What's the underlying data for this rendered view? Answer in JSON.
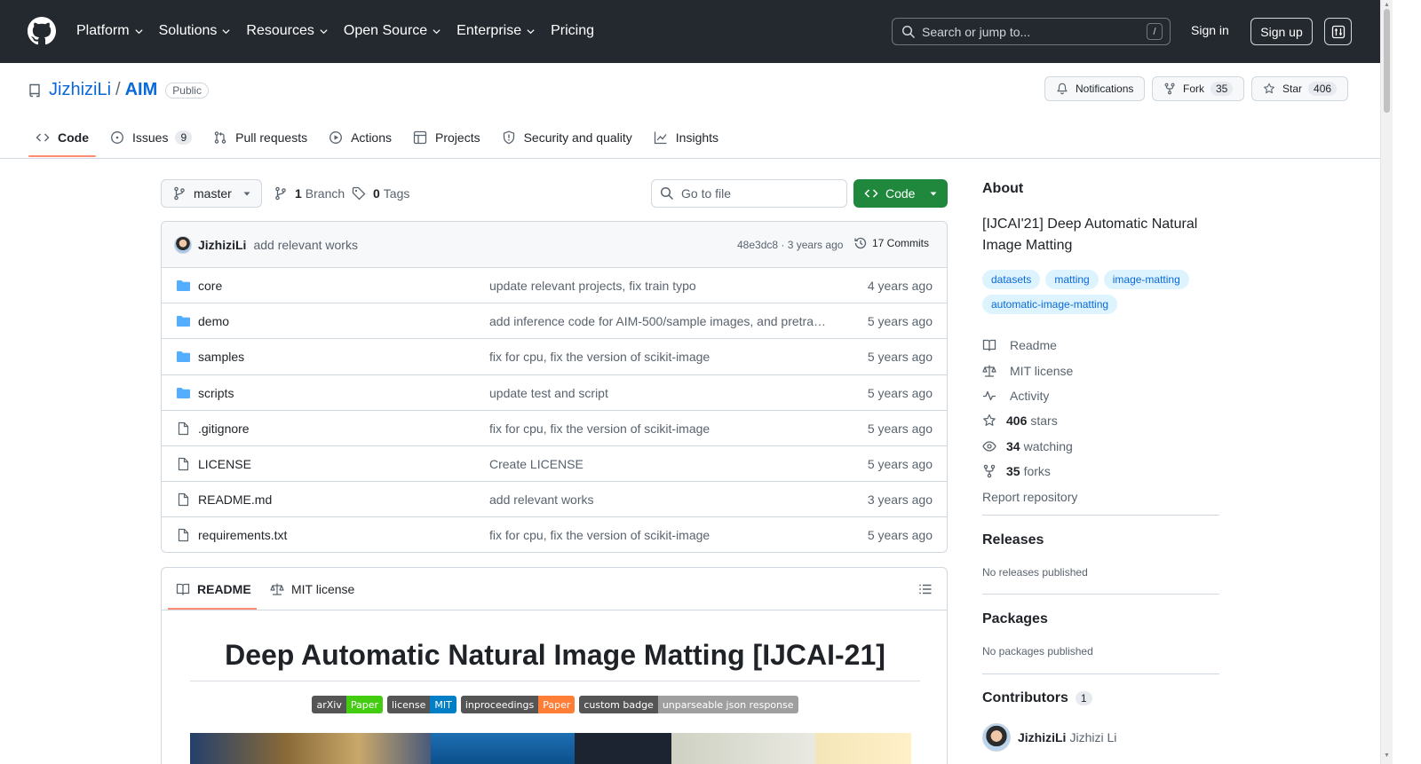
{
  "header": {
    "nav": [
      {
        "label": "Platform",
        "has_menu": true
      },
      {
        "label": "Solutions",
        "has_menu": true
      },
      {
        "label": "Resources",
        "has_menu": true
      },
      {
        "label": "Open Source",
        "has_menu": true
      },
      {
        "label": "Enterprise",
        "has_menu": true
      },
      {
        "label": "Pricing",
        "has_menu": false
      }
    ],
    "search_placeholder": "Search or jump to...",
    "search_key": "/",
    "signin": "Sign in",
    "signup": "Sign up"
  },
  "repo": {
    "owner": "JizhiziLi",
    "separator": "/",
    "name": "AIM",
    "visibility": "Public",
    "notifications_label": "Notifications",
    "fork_label": "Fork",
    "fork_count": "35",
    "star_label": "Star",
    "star_count": "406"
  },
  "tabs": [
    {
      "label": "Code",
      "icon": "code-icon",
      "count": null,
      "active": true
    },
    {
      "label": "Issues",
      "icon": "issue-icon",
      "count": "9",
      "active": false
    },
    {
      "label": "Pull requests",
      "icon": "pull-request-icon",
      "count": null,
      "active": false
    },
    {
      "label": "Actions",
      "icon": "play-icon",
      "count": null,
      "active": false
    },
    {
      "label": "Projects",
      "icon": "table-icon",
      "count": null,
      "active": false
    },
    {
      "label": "Security and quality",
      "icon": "shield-icon",
      "count": null,
      "active": false
    },
    {
      "label": "Insights",
      "icon": "graph-icon",
      "count": null,
      "active": false
    }
  ],
  "toolbar": {
    "branch": "master",
    "branch_count": "1",
    "branch_label": "Branch",
    "tag_count": "0",
    "tag_label": "Tags",
    "goto_placeholder": "Go to file",
    "code_label": "Code"
  },
  "commit": {
    "author": "JizhiziLi",
    "message": "add relevant works",
    "meta": "48e3dc8 · 3 years ago",
    "commits": "17 Commits"
  },
  "files": [
    {
      "name": "core",
      "type": "folder",
      "message": "update relevant projects, fix train typo",
      "date": "4 years ago"
    },
    {
      "name": "demo",
      "type": "folder",
      "message": "add inference code for AIM-500/sample images, and pretrained model",
      "date": "5 years ago"
    },
    {
      "name": "samples",
      "type": "folder",
      "message": "fix for cpu, fix the version of scikit-image",
      "date": "5 years ago"
    },
    {
      "name": "scripts",
      "type": "folder",
      "message": "update test and script",
      "date": "5 years ago"
    },
    {
      "name": ".gitignore",
      "type": "file",
      "message": "fix for cpu, fix the version of scikit-image",
      "date": "5 years ago"
    },
    {
      "name": "LICENSE",
      "type": "file",
      "message": "Create LICENSE",
      "date": "5 years ago"
    },
    {
      "name": "README.md",
      "type": "file",
      "message": "add relevant works",
      "date": "3 years ago"
    },
    {
      "name": "requirements.txt",
      "type": "file",
      "message": "fix for cpu, fix the version of scikit-image",
      "date": "5 years ago"
    }
  ],
  "readme": {
    "tab_readme": "README",
    "tab_license": "MIT license",
    "title": "Deep Automatic Natural Image Matting [IJCAI-21]",
    "badges": [
      {
        "left": "arXiv",
        "right": "Paper",
        "color": "#4c1"
      },
      {
        "left": "license",
        "right": "MIT",
        "color": "#007ec6"
      },
      {
        "left": "inproceedings",
        "right": "Paper",
        "color": "#fe7d37"
      },
      {
        "left": "custom badge",
        "right": "unparseable json response",
        "color": "#9f9f9f"
      }
    ]
  },
  "sidebar": {
    "about_title": "About",
    "description": "[IJCAI'21] Deep Automatic Natural Image Matting",
    "topics": [
      "datasets",
      "matting",
      "image-matting",
      "automatic-image-matting"
    ],
    "links": [
      {
        "icon": "book-icon",
        "bold": "",
        "label": "Readme"
      },
      {
        "icon": "law-icon",
        "bold": "",
        "label": "MIT license"
      },
      {
        "icon": "pulse-icon",
        "bold": "",
        "label": "Activity"
      },
      {
        "icon": "star-icon",
        "bold": "406",
        "label": "stars"
      },
      {
        "icon": "eye-icon",
        "bold": "34",
        "label": "watching"
      },
      {
        "icon": "fork-icon",
        "bold": "35",
        "label": "forks"
      }
    ],
    "report": "Report repository",
    "releases_title": "Releases",
    "releases_text": "No releases published",
    "packages_title": "Packages",
    "packages_text": "No packages published",
    "contributors_title": "Contributors",
    "contributors_count": "1",
    "contributor_login": "JizhiziLi",
    "contributor_name": "Jizhizi Li"
  },
  "colors": {
    "header_bg": "#24292f",
    "link": "#0969da",
    "primary_button": "#1f883d",
    "tab_underline": "#fd8c73"
  }
}
